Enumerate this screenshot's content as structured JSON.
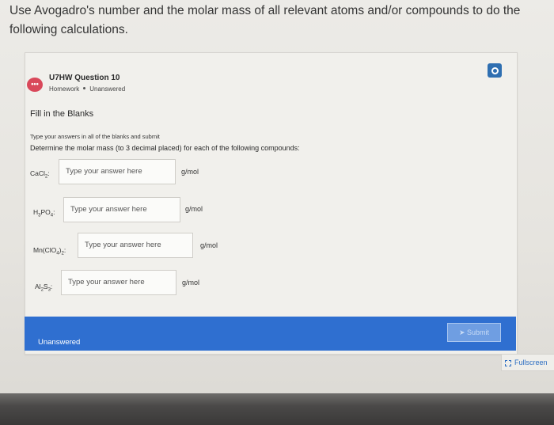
{
  "instruction": "Use Avogadro's number and the molar mass of all relevant atoms and/or compounds to do the following calculations.",
  "question": {
    "title": "U7HW Question 10",
    "type": "Homework",
    "status": "Unanswered"
  },
  "content": {
    "heading": "Fill in the Blanks",
    "type_instructions": "Type your answers in all of the blanks and submit",
    "prompt": "Determine the molar mass (to 3 decimal placed) for each of the following compounds:"
  },
  "rows": [
    {
      "formula_main": "CaCl",
      "formula_sub": "2",
      "formula_tail": "",
      "suffix": ":",
      "placeholder": "Type your answer here",
      "unit": "g/mol"
    },
    {
      "formula_main": "H",
      "formula_sub": "3",
      "formula_tail": "PO",
      "tail_sub": "4",
      "suffix": ":",
      "placeholder": "Type your answer here",
      "unit": "g/mol"
    },
    {
      "formula_main": "Mn(ClO",
      "formula_sub": "4",
      "formula_tail": ")",
      "tail_sub": "2",
      "suffix": ":",
      "placeholder": "Type your answer here",
      "unit": "g/mol"
    },
    {
      "formula_main": "Al",
      "formula_sub": "2",
      "formula_tail": "S",
      "tail_sub": "3",
      "suffix": ":",
      "placeholder": "Type your answer here",
      "unit": "g/mol"
    }
  ],
  "footer": {
    "status": "Unanswered",
    "submit_label": "Submit"
  },
  "fullscreen_label": "Fullscreen",
  "colors": {
    "accent_blue": "#2f6fd0",
    "badge_red": "#d9485a"
  },
  "icons": {
    "chat": "chat-bubble-icon",
    "settings": "settings-icon",
    "submit": "send-icon",
    "fullscreen": "fullscreen-icon"
  }
}
